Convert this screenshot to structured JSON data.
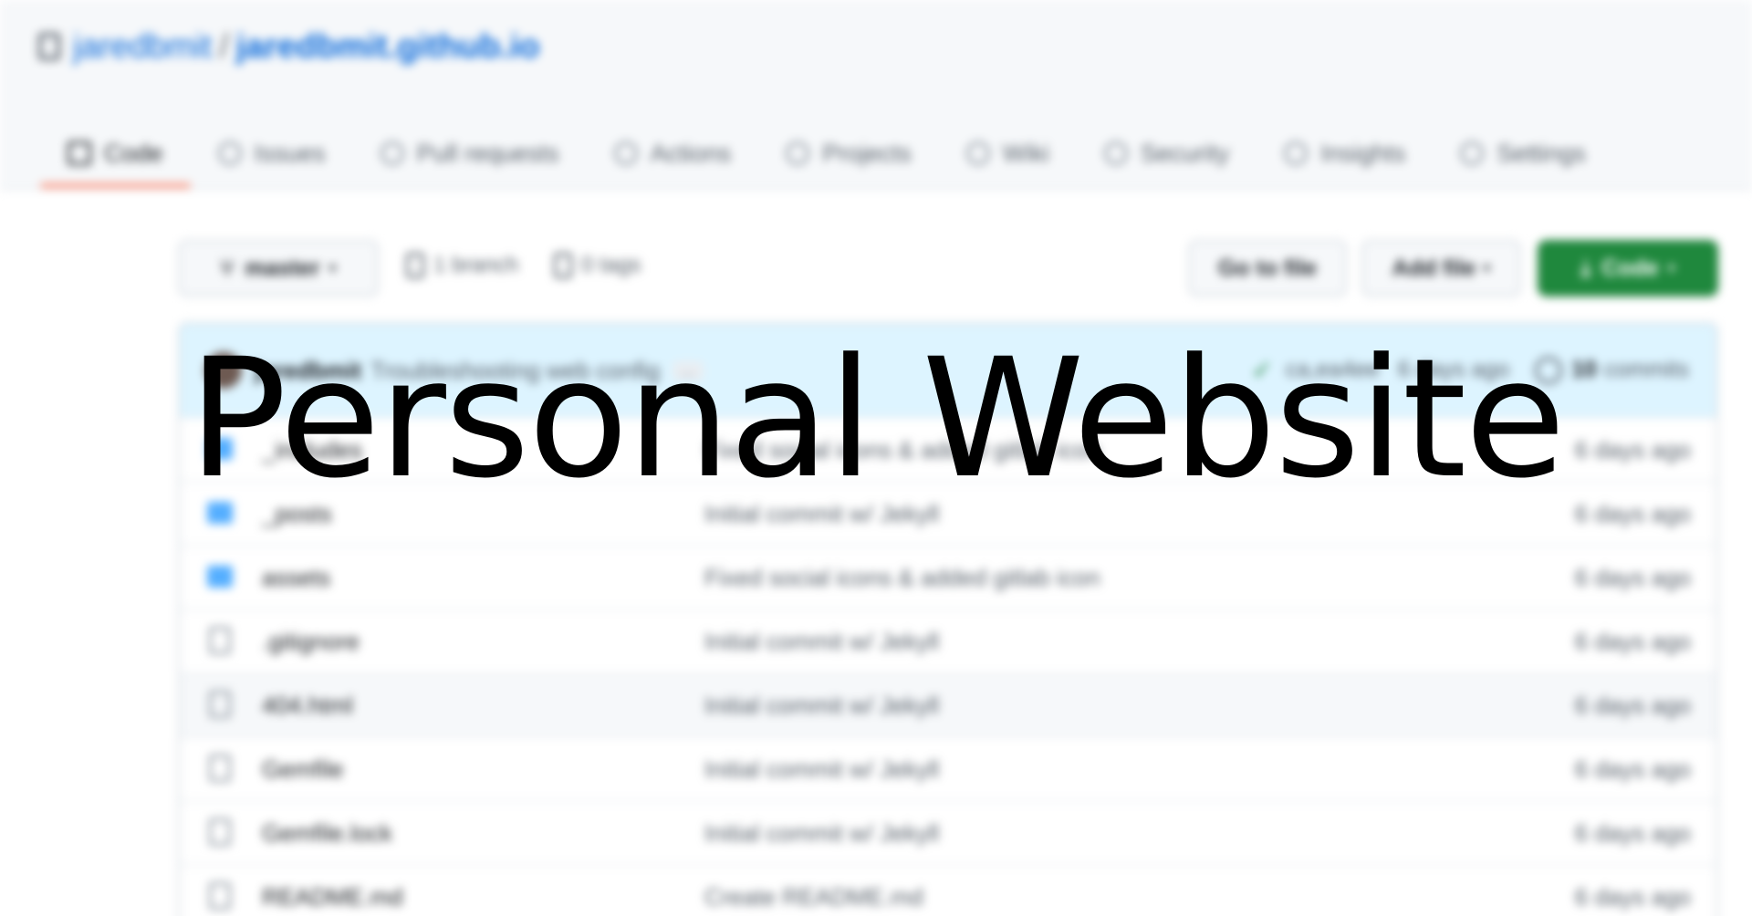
{
  "overlay": {
    "title": "Personal Website"
  },
  "repo": {
    "owner": "jaredbmit",
    "separator": "/",
    "name": "jaredbmit.github.io",
    "icon": "repo-icon"
  },
  "tabs": [
    {
      "label": "Code",
      "icon": "code-icon",
      "active": true
    },
    {
      "label": "Issues",
      "icon": "issue-icon"
    },
    {
      "label": "Pull requests",
      "icon": "pull-request-icon"
    },
    {
      "label": "Actions",
      "icon": "actions-icon"
    },
    {
      "label": "Projects",
      "icon": "projects-icon"
    },
    {
      "label": "Wiki",
      "icon": "wiki-icon"
    },
    {
      "label": "Security",
      "icon": "shield-icon"
    },
    {
      "label": "Insights",
      "icon": "graph-icon"
    },
    {
      "label": "Settings",
      "icon": "gear-icon"
    }
  ],
  "toolbar": {
    "branch": "master",
    "branches": "1 branch",
    "tags": "0 tags",
    "go_to_file": "Go to file",
    "add_file": "Add file",
    "code": "Code"
  },
  "commit": {
    "author": "jaredbmit",
    "message": "Troubleshooting web config",
    "ellipsis": "…",
    "hash": "ca,ea4ee",
    "time": "6 days ago",
    "commits": "10",
    "commits_label": "commits"
  },
  "files": [
    {
      "type": "folder",
      "name": "_includes",
      "message": "Fixed social icons & added gitlab icon",
      "age": "6 days ago"
    },
    {
      "type": "folder",
      "name": "_posts",
      "message": "Initial commit w/ Jekyll",
      "age": "6 days ago"
    },
    {
      "type": "folder",
      "name": "assets",
      "message": "Fixed social icons & added gitlab icon",
      "age": "6 days ago"
    },
    {
      "type": "file",
      "name": ".gitignore",
      "message": "Initial commit w/ Jekyll",
      "age": "6 days ago"
    },
    {
      "type": "file",
      "name": "404.html",
      "message": "Initial commit w/ Jekyll",
      "age": "6 days ago"
    },
    {
      "type": "file",
      "name": "Gemfile",
      "message": "Initial commit w/ Jekyll",
      "age": "6 days ago"
    },
    {
      "type": "file",
      "name": "Gemfile.lock",
      "message": "Initial commit w/ Jekyll",
      "age": "6 days ago"
    },
    {
      "type": "file",
      "name": "README.md",
      "message": "Create README.md",
      "age": "6 days ago"
    }
  ],
  "colors": {
    "accent": "#0969da",
    "primary_button": "#1f883d",
    "active_tab_underline": "#fd8c73",
    "folder": "#54aeff"
  }
}
